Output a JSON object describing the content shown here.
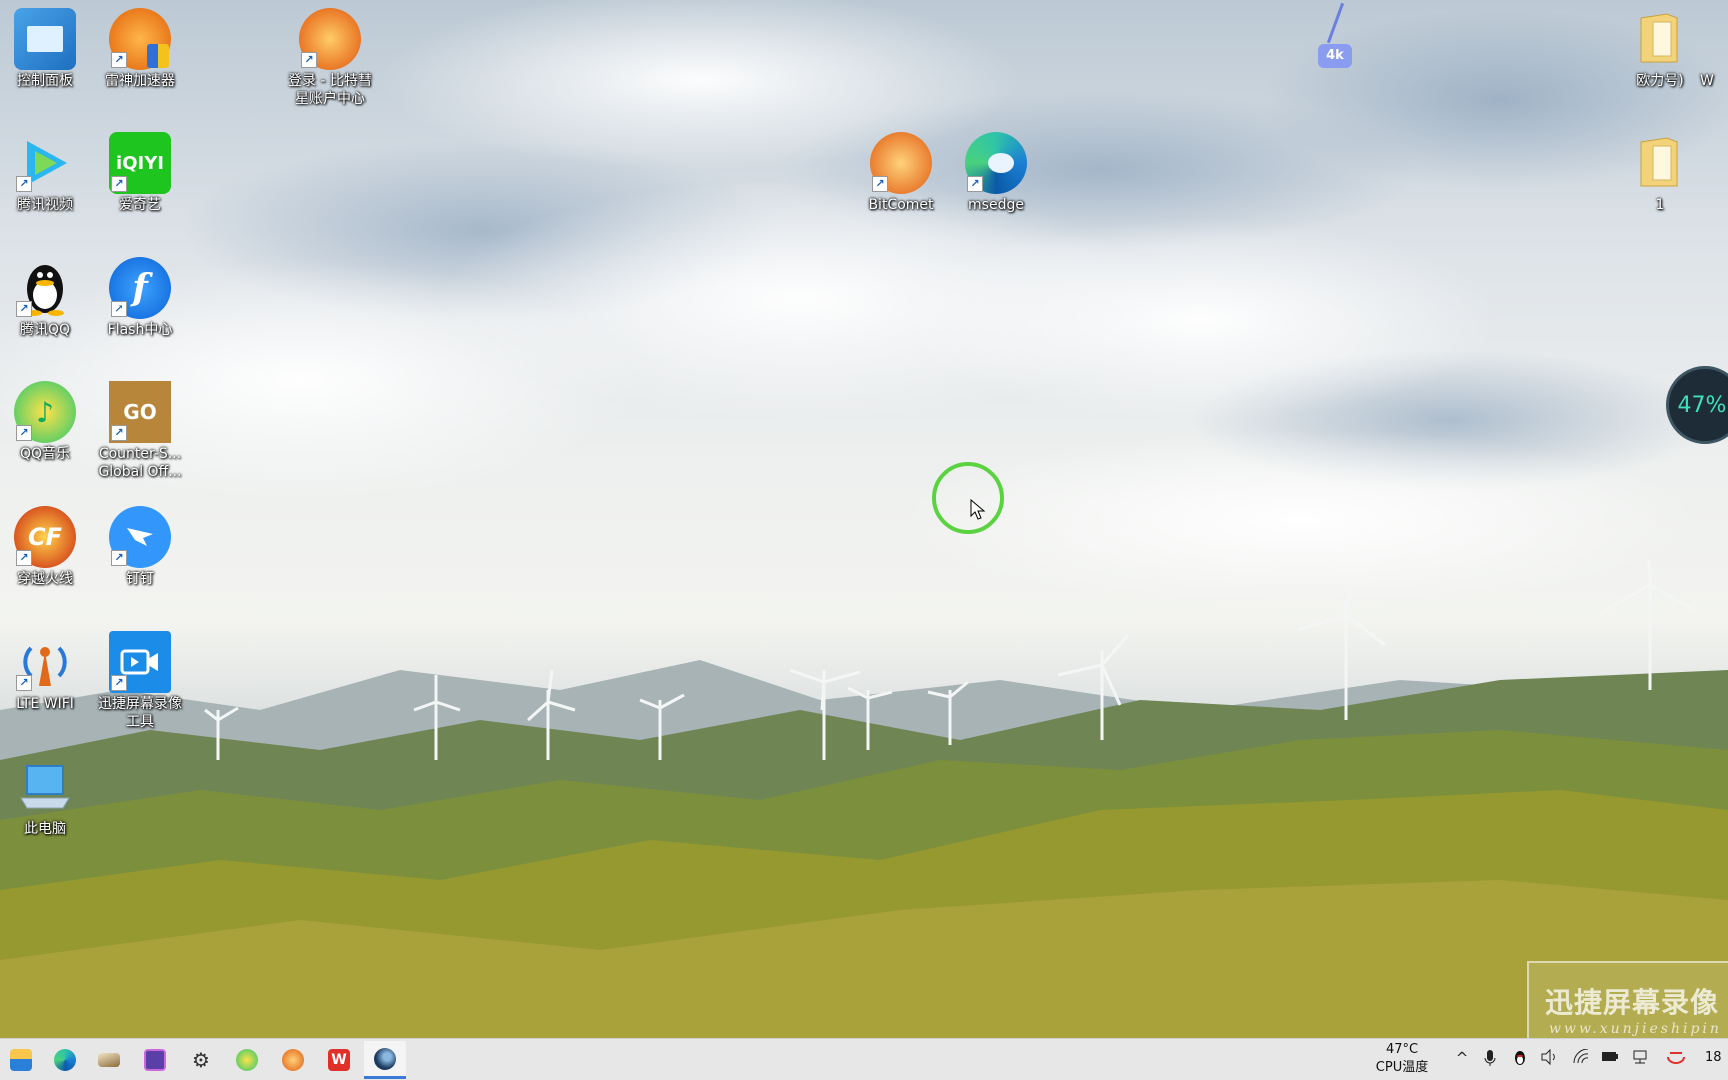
{
  "desktop": {
    "icons": [
      {
        "label": "控制面板",
        "icon": "control-panel-icon"
      },
      {
        "label": "雷神加速器",
        "icon": "leishen-accelerator-icon"
      },
      {
        "label": "登录 - 比特彗星账户中心",
        "icon": "bitcomet-login-icon"
      },
      {
        "label": "腾讯视频",
        "icon": "tencent-video-icon"
      },
      {
        "label": "爱奇艺",
        "icon": "iqiyi-icon"
      },
      {
        "label": "BitComet",
        "icon": "bitcomet-icon"
      },
      {
        "label": "msedge",
        "icon": "edge-icon"
      },
      {
        "label": "腾讯QQ",
        "icon": "qq-icon"
      },
      {
        "label": "Flash中心",
        "icon": "flash-center-icon"
      },
      {
        "label": "QQ音乐",
        "icon": "qq-music-icon"
      },
      {
        "label": "Counter-S... Global Off...",
        "icon": "csgo-icon"
      },
      {
        "label": "穿越火线",
        "icon": "crossfire-icon"
      },
      {
        "label": "钉钉",
        "icon": "dingtalk-icon"
      },
      {
        "label": "LTE WIFI",
        "icon": "lte-wifi-icon"
      },
      {
        "label": "迅捷屏幕录像工具",
        "icon": "screen-recorder-icon"
      },
      {
        "label": "此电脑",
        "icon": "this-pc-icon"
      },
      {
        "label": "欧力号)",
        "icon": "folder-icon"
      },
      {
        "label": "1",
        "icon": "folder-icon"
      },
      {
        "label": "W",
        "icon": "partial-icon"
      }
    ],
    "widget_4k_badge": "4k",
    "gauge_value": "47%",
    "watermark": {
      "cn": "迅捷屏幕录像",
      "en": "www.xunjieshipin"
    }
  },
  "taskbar": {
    "apps": [
      "file-explorer-icon",
      "edge-icon",
      "notes-icon",
      "video-player-icon",
      "settings-icon",
      "qq-music-icon",
      "bitcomet-icon",
      "wps-icon",
      "steam-icon"
    ],
    "active_app": "steam-icon",
    "temperature": "47°C",
    "temperature_label": "CPU温度",
    "clock_partial": "18",
    "tray": [
      "chevron-up-icon",
      "microphone-icon",
      "qq-tray-icon",
      "volume-icon",
      "wifi-icon",
      "battery-icon",
      "network-icon",
      "ime-icon"
    ]
  },
  "colors": {
    "taskbar_bg": "#e7e7e7",
    "active_indicator": "#3a7bd5",
    "cursor_ring": "#5bd341",
    "gauge_text": "#3fe0b8"
  }
}
